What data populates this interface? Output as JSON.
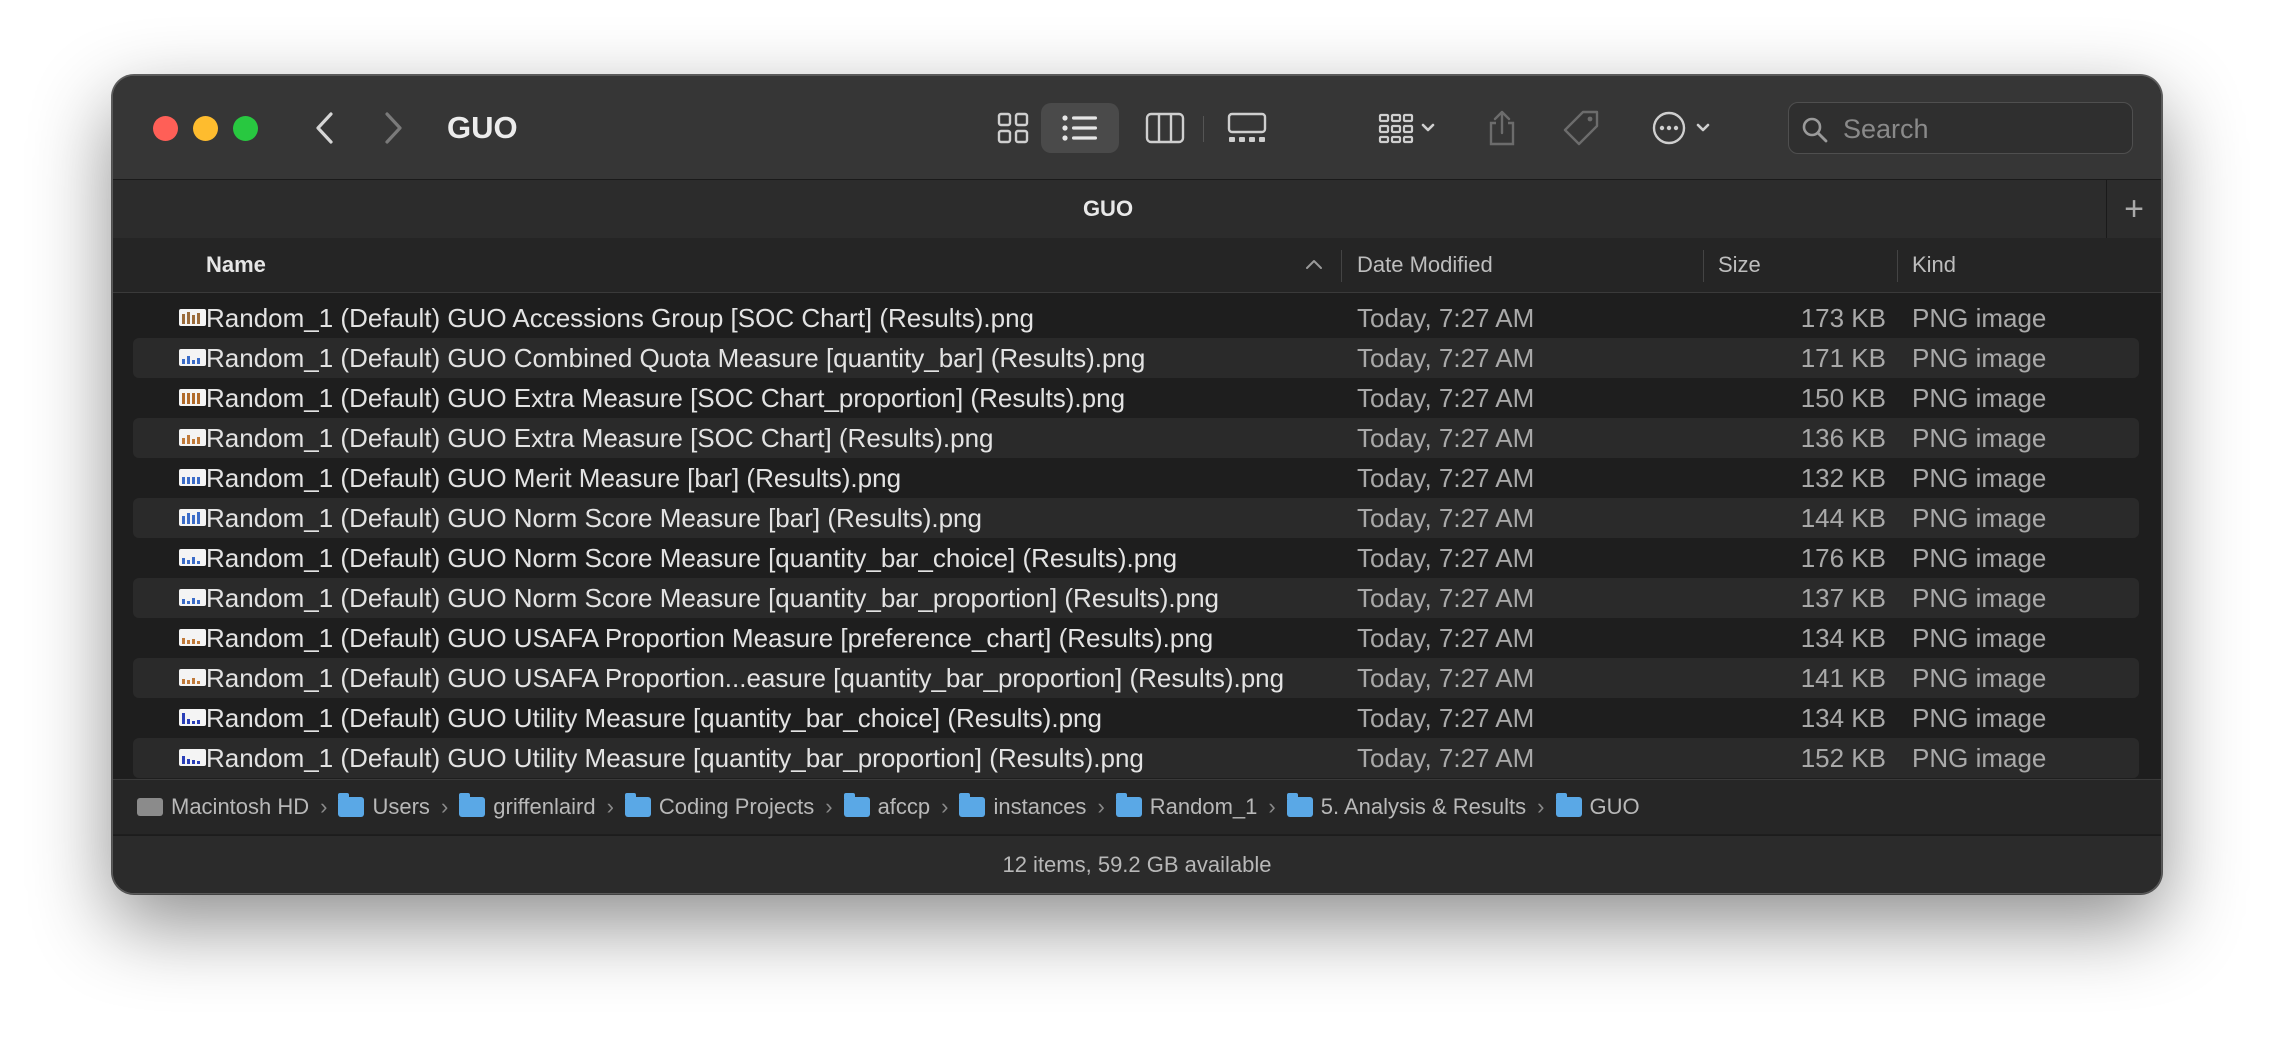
{
  "window": {
    "title": "GUO",
    "tab_label": "GUO",
    "tab_add": "+",
    "search_placeholder": "Search"
  },
  "toolbar_icons": [
    "chevron-left-icon",
    "chevron-right-icon",
    "icon-view-icon",
    "list-view-icon",
    "column-view-icon",
    "gallery-view-icon",
    "group-icon",
    "share-icon",
    "tag-icon",
    "more-actions-icon",
    "search-icon"
  ],
  "columns": {
    "name": "Name",
    "date": "Date Modified",
    "size": "Size",
    "kind": "Kind"
  },
  "files": [
    {
      "name": "Random_1 (Default) GUO Accessions Group [SOC Chart] (Results).png",
      "date": "Today, 7:27 AM",
      "size": "173 KB",
      "kind": "PNG image"
    },
    {
      "name": "Random_1 (Default) GUO Combined Quota Measure [quantity_bar] (Results).png",
      "date": "Today, 7:27 AM",
      "size": "171 KB",
      "kind": "PNG image"
    },
    {
      "name": "Random_1 (Default) GUO Extra Measure [SOC Chart_proportion] (Results).png",
      "date": "Today, 7:27 AM",
      "size": "150 KB",
      "kind": "PNG image"
    },
    {
      "name": "Random_1 (Default) GUO Extra Measure [SOC Chart] (Results).png",
      "date": "Today, 7:27 AM",
      "size": "136 KB",
      "kind": "PNG image"
    },
    {
      "name": "Random_1 (Default) GUO Merit Measure [bar] (Results).png",
      "date": "Today, 7:27 AM",
      "size": "132 KB",
      "kind": "PNG image"
    },
    {
      "name": "Random_1 (Default) GUO Norm Score Measure [bar] (Results).png",
      "date": "Today, 7:27 AM",
      "size": "144 KB",
      "kind": "PNG image"
    },
    {
      "name": "Random_1 (Default) GUO Norm Score Measure [quantity_bar_choice] (Results).png",
      "date": "Today, 7:27 AM",
      "size": "176 KB",
      "kind": "PNG image"
    },
    {
      "name": "Random_1 (Default) GUO Norm Score Measure [quantity_bar_proportion] (Results).png",
      "date": "Today, 7:27 AM",
      "size": "137 KB",
      "kind": "PNG image"
    },
    {
      "name": "Random_1 (Default) GUO USAFA Proportion Measure [preference_chart] (Results).png",
      "date": "Today, 7:27 AM",
      "size": "134 KB",
      "kind": "PNG image"
    },
    {
      "name": "Random_1 (Default) GUO USAFA Proportion...easure [quantity_bar_proportion] (Results).png",
      "date": "Today, 7:27 AM",
      "size": "141 KB",
      "kind": "PNG image"
    },
    {
      "name": "Random_1 (Default) GUO Utility Measure [quantity_bar_choice] (Results).png",
      "date": "Today, 7:27 AM",
      "size": "134 KB",
      "kind": "PNG image"
    },
    {
      "name": "Random_1 (Default) GUO Utility Measure [quantity_bar_proportion] (Results).png",
      "date": "Today, 7:27 AM",
      "size": "152 KB",
      "kind": "PNG image"
    }
  ],
  "path": [
    {
      "label": "Macintosh HD",
      "icon": "drive-icon"
    },
    {
      "label": "Users",
      "icon": "folder-icon"
    },
    {
      "label": "griffenlaird",
      "icon": "folder-icon"
    },
    {
      "label": "Coding Projects",
      "icon": "folder-icon"
    },
    {
      "label": "afccp",
      "icon": "folder-icon"
    },
    {
      "label": "instances",
      "icon": "folder-icon"
    },
    {
      "label": "Random_1",
      "icon": "folder-icon"
    },
    {
      "label": "5. Analysis & Results",
      "icon": "folder-icon"
    },
    {
      "label": "GUO",
      "icon": "folder-icon"
    }
  ],
  "status": "12 items, 59.2 GB available",
  "colors": {
    "close": "#ff5f57",
    "minimize": "#febc2e",
    "zoom": "#28c840",
    "folder": "#5aa8e6"
  }
}
